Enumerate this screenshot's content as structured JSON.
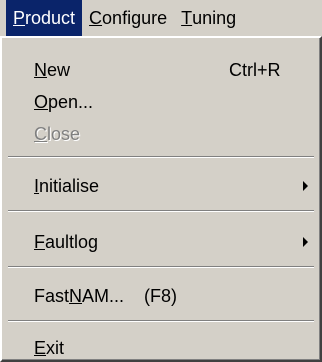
{
  "menubar": {
    "items": [
      {
        "underline": "P",
        "rest": "roduct"
      },
      {
        "underline": "C",
        "rest": "onfigure"
      },
      {
        "underline": "T",
        "rest": "uning"
      }
    ]
  },
  "menu": {
    "new": {
      "underline": "N",
      "rest": "ew",
      "shortcut": "Ctrl+R"
    },
    "open": {
      "underline": "O",
      "rest": "pen..."
    },
    "close": {
      "underline": "C",
      "rest": "lose"
    },
    "initialise": {
      "underline": "I",
      "rest": "nitialise"
    },
    "faultlog": {
      "underline": "F",
      "rest": "aultlog"
    },
    "fastnam": {
      "pre": "Fast",
      "underline": "N",
      "rest": "AM...",
      "shortcut": "(F8)"
    },
    "exit": {
      "underline": "E",
      "rest": "xit"
    }
  },
  "colors": {
    "menu_face": "#d4d0c8",
    "highlight": "#0a246a",
    "disabled_text": "#808080"
  }
}
